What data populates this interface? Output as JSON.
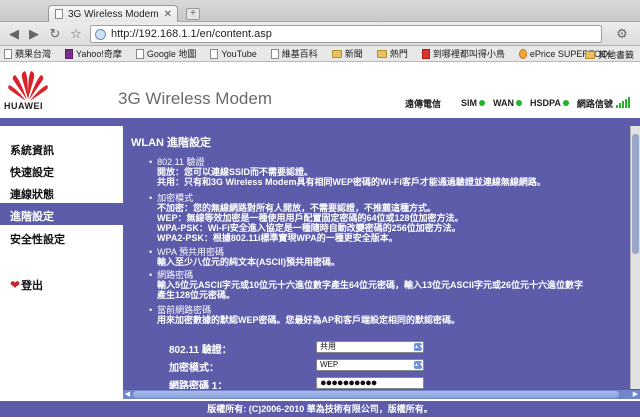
{
  "browser": {
    "tab_title": "3G Wireless Modem",
    "address": "http://192.168.1.1/en/content.asp",
    "bookmarks": [
      "蘋果台灣",
      "Yahoo!奇摩",
      "Google 地圖",
      "YouTube",
      "維基百科",
      "新聞",
      "熱門",
      "到哪裡都叫得小鳥",
      "ePrice SUPERTOOL"
    ],
    "other_bookmarks": "其他書籤"
  },
  "header": {
    "brand": "HUAWEI",
    "product_title": "3G Wireless Modem",
    "status": {
      "operator": "遠傳電信",
      "sim": "SIM",
      "wan": "WAN",
      "network": "HSDPA",
      "signal_label": "網路信號",
      "signal_level": 5,
      "indicator_color": "#22b32a"
    }
  },
  "sidebar": {
    "items": [
      "系統資訊",
      "快速設定",
      "連線狀態",
      "進階設定",
      "安全性設定"
    ],
    "active_index": 3,
    "logout": "登出"
  },
  "main": {
    "title": "WLAN 進階設定",
    "sections": [
      {
        "heading": "802.11 驗證",
        "lines": [
          "開放：您可以連線SSID而不需要認證。",
          "共用：只有和3G Wireless Modem具有相同WEP密碼的Wi-Fi客戶才能通過驗證並連線無線網路。"
        ]
      },
      {
        "heading": "加密模式",
        "lines": [
          "不加密：您的無線網路對所有人開放，不需要認證，不推薦這種方式。",
          "WEP：無線等效加密是一種使用用戶配置固定密碼的64位或128位加密方法。",
          "WPA-PSK：Wi-Fi安全進入協定是一種隨時自動改變密碼的256位加密方法。",
          "WPA2-PSK：根據802.11i標準實現WPA的一種更安全版本。"
        ]
      },
      {
        "heading": "WPA 預共用密碼",
        "lines": [
          "輸入至少八位元的純文本(ASCII)預共用密碼。"
        ]
      },
      {
        "heading": "網路密碼",
        "lines": [
          "輸入5位元ASCII字元或10位元十六進位數字產生64位元密碼，輸入13位元ASCII字元或26位元十六進位數字",
          "產生128位元密碼。"
        ]
      },
      {
        "heading": "當前網路密碼",
        "lines": [
          "用來加密數據的默認WEP密碼。您最好為AP和客戶端設定相同的默認密碼。"
        ]
      }
    ],
    "form": {
      "auth_label": "802.11 驗證：",
      "auth_value": "共用",
      "enc_label": "加密模式：",
      "enc_value": "WEP",
      "key_label": "網路密碼 1：",
      "key_value": "●●●●●●●●●●"
    },
    "accent_color": "#5d5cab"
  },
  "footer": {
    "copyright": "版權所有: (C)2006-2010 華為技術有限公司，版權所有。"
  }
}
